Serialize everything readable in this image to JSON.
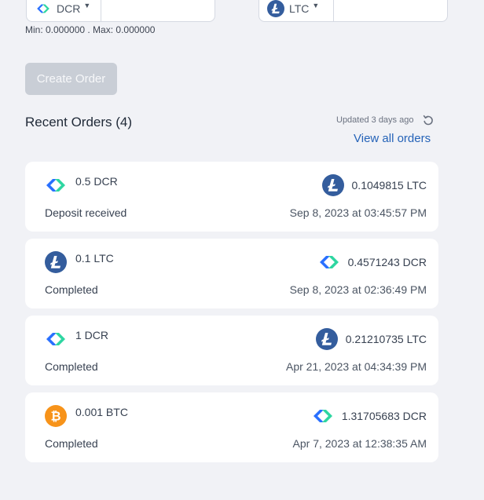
{
  "exchange": {
    "from_currency": "DCR",
    "from_icon": "decred-icon",
    "to_currency": "LTC",
    "to_icon": "litecoin-icon",
    "arrow_icon": "exchange-arrow-icon",
    "limits_text": "Min: 0.000000 . Max: 0.000000"
  },
  "actions": {
    "create_order_label": "Create Order"
  },
  "recent": {
    "title": "Recent Orders (4)",
    "updated": "Updated 3 days ago",
    "refresh_icon": "refresh-icon",
    "view_all": "View all orders"
  },
  "orders": [
    {
      "from_icon": "decred-icon",
      "from_amount": "0.5 DCR",
      "to_icon": "litecoin-icon",
      "to_amount": "0.1049815 LTC",
      "status": "Deposit received",
      "date": "Sep 8, 2023 at 03:45:57 PM"
    },
    {
      "from_icon": "litecoin-icon",
      "from_amount": "0.1 LTC",
      "to_icon": "decred-icon",
      "to_amount": "0.4571243 DCR",
      "status": "Completed",
      "date": "Sep 8, 2023 at 02:36:49 PM"
    },
    {
      "from_icon": "decred-icon",
      "from_amount": "1 DCR",
      "to_icon": "litecoin-icon",
      "to_amount": "0.21210735 LTC",
      "status": "Completed",
      "date": "Apr 21, 2023 at 04:34:39 PM"
    },
    {
      "from_icon": "bitcoin-icon",
      "from_amount": "0.001 BTC",
      "to_icon": "decred-icon",
      "to_amount": "1.31705683 DCR",
      "status": "Completed",
      "date": "Apr 7, 2023 at 12:38:35 AM"
    }
  ],
  "colors": {
    "decred_blue": "#2970ff",
    "decred_green": "#2ed6a1",
    "litecoin": "#345d9d",
    "bitcoin": "#f7931a",
    "link": "#2563b8",
    "button_disabled": "#c9ced6"
  }
}
